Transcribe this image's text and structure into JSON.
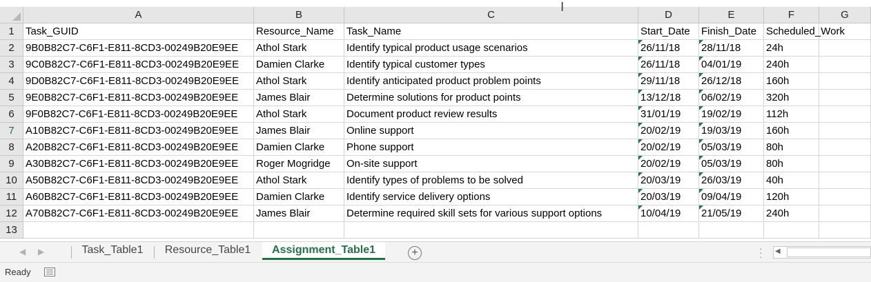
{
  "columns": [
    "A",
    "B",
    "C",
    "D",
    "E",
    "F",
    "G"
  ],
  "rows": [
    {
      "num": "1",
      "cells": [
        "Task_GUID",
        "Resource_Name",
        "Task_Name",
        "Start_Date",
        "Finish_Date",
        "Scheduled_Work",
        ""
      ]
    },
    {
      "num": "2",
      "cells": [
        "9B0B82C7-C6F1-E811-8CD3-00249B20E9EE",
        "Athol Stark",
        "Identify typical product usage scenarios",
        "26/11/18",
        "28/11/18",
        "24h",
        ""
      ]
    },
    {
      "num": "3",
      "cells": [
        "9C0B82C7-C6F1-E811-8CD3-00249B20E9EE",
        "Damien Clarke",
        "Identify typical customer types",
        "26/11/18",
        "04/01/19",
        "240h",
        ""
      ]
    },
    {
      "num": "4",
      "cells": [
        "9D0B82C7-C6F1-E811-8CD3-00249B20E9EE",
        "Athol Stark",
        "Identify anticipated product problem points",
        "29/11/18",
        "26/12/18",
        "160h",
        ""
      ]
    },
    {
      "num": "5",
      "cells": [
        "9E0B82C7-C6F1-E811-8CD3-00249B20E9EE",
        "James Blair",
        "Determine solutions for product points",
        "13/12/18",
        "06/02/19",
        "320h",
        ""
      ]
    },
    {
      "num": "6",
      "cells": [
        "9F0B82C7-C6F1-E811-8CD3-00249B20E9EE",
        "Athol Stark",
        "Document product review results",
        "31/01/19",
        "19/02/19",
        "112h",
        ""
      ]
    },
    {
      "num": "7",
      "cells": [
        "A10B82C7-C6F1-E811-8CD3-00249B20E9EE",
        "James Blair",
        "Online support",
        "20/02/19",
        "19/03/19",
        "160h",
        ""
      ]
    },
    {
      "num": "8",
      "cells": [
        "A20B82C7-C6F1-E811-8CD3-00249B20E9EE",
        "Damien Clarke",
        "Phone support",
        "20/02/19",
        "05/03/19",
        "80h",
        ""
      ]
    },
    {
      "num": "9",
      "cells": [
        "A30B82C7-C6F1-E811-8CD3-00249B20E9EE",
        "Roger Mogridge",
        "On-site support",
        "20/02/19",
        "05/03/19",
        "80h",
        ""
      ]
    },
    {
      "num": "10",
      "cells": [
        "A50B82C7-C6F1-E811-8CD3-00249B20E9EE",
        "Athol Stark",
        "Identify types of problems to be solved",
        "20/03/19",
        "26/03/19",
        "40h",
        ""
      ]
    },
    {
      "num": "11",
      "cells": [
        "A60B82C7-C6F1-E811-8CD3-00249B20E9EE",
        "Damien Clarke",
        "Identify service delivery options",
        "20/03/19",
        "09/04/19",
        "120h",
        ""
      ]
    },
    {
      "num": "12",
      "cells": [
        "A70B82C7-C6F1-E811-8CD3-00249B20E9EE",
        "James Blair",
        "Determine required skill sets for various support options",
        "10/04/19",
        "21/05/19",
        "240h",
        ""
      ]
    },
    {
      "num": "13",
      "cells": [
        "",
        "",
        "",
        "",
        "",
        "",
        ""
      ]
    }
  ],
  "active_row": "7",
  "sheet_tabs": [
    {
      "label": "Task_Table1",
      "active": false
    },
    {
      "label": "Resource_Table1",
      "active": false
    },
    {
      "label": "Assignment_Table1",
      "active": true
    }
  ],
  "status": {
    "text": "Ready"
  },
  "icons": {
    "add_sheet": "plus-circle-icon",
    "cursor": "i-beam-cursor-icon",
    "macro": "macro-recording-icon"
  },
  "colors": {
    "accent": "#217346",
    "error_indicator": "#1e7a45",
    "header_bg": "#e6e6e6"
  }
}
